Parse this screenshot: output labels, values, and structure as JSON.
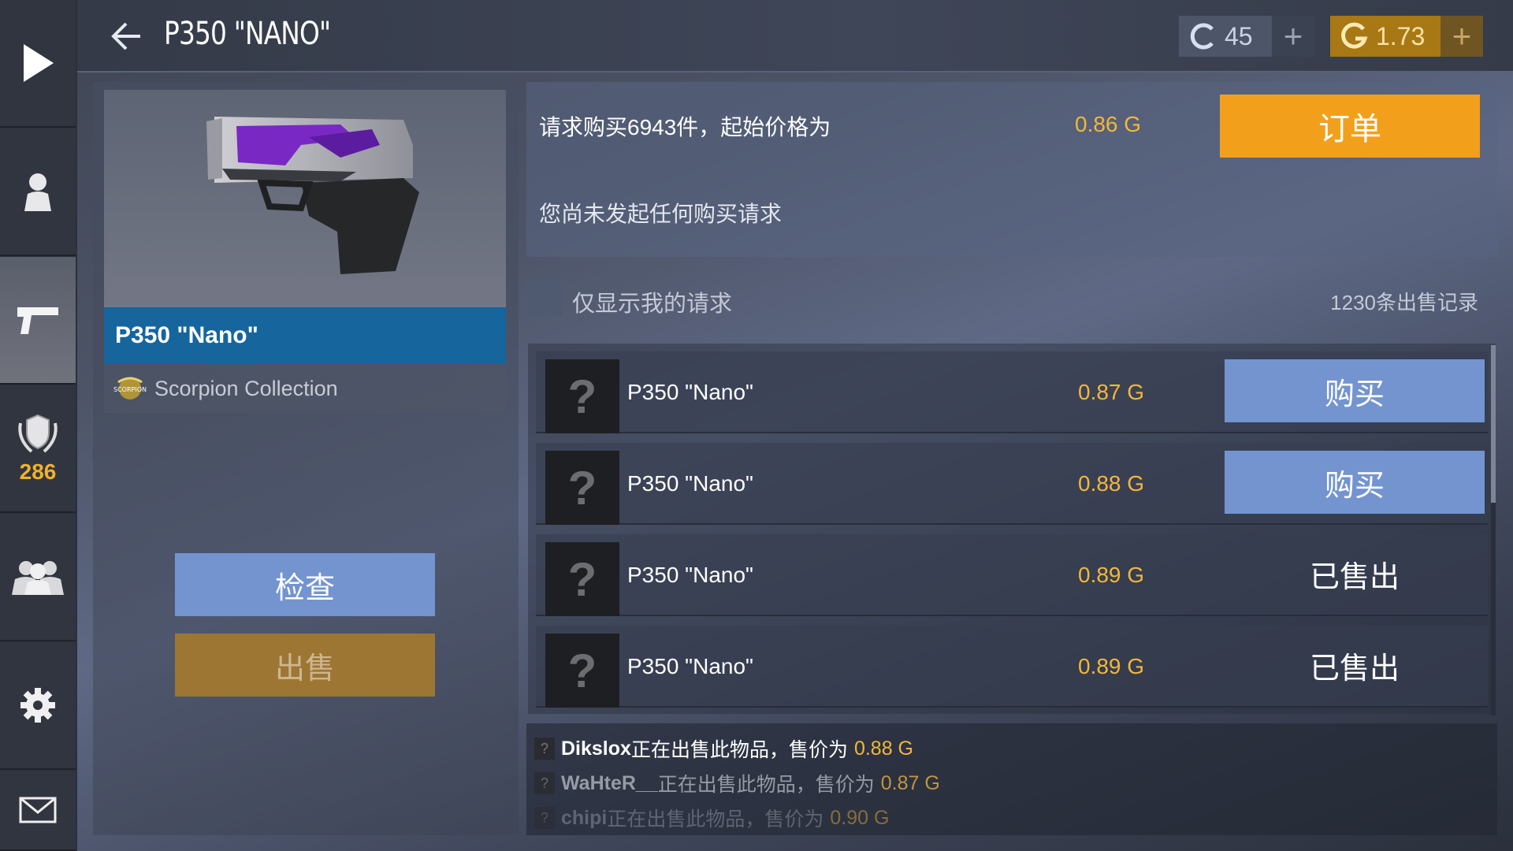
{
  "header": {
    "title": "P350 \"NANO\"",
    "currency_c": {
      "value": "45",
      "plus": "+"
    },
    "currency_g": {
      "value": "1.73",
      "plus": "+"
    }
  },
  "sidebar": {
    "items": [
      {
        "icon": "play-icon"
      },
      {
        "icon": "profile-icon"
      },
      {
        "icon": "pistol-icon",
        "active": true
      },
      {
        "icon": "rank-shield-icon",
        "count": "286"
      },
      {
        "icon": "friends-icon"
      },
      {
        "icon": "gear-icon"
      },
      {
        "icon": "mail-icon"
      }
    ]
  },
  "item": {
    "name": "P350 \"Nano\"",
    "collection": "Scorpion Collection",
    "collection_logo_text": "SCORPION",
    "inspect_label": "检查",
    "sell_label": "出售"
  },
  "order": {
    "request_text": "请求购买6943件，起始价格为",
    "start_price": "0.86 G",
    "order_button": "订单",
    "no_requests": "您尚未发起任何购买请求"
  },
  "filter": {
    "label": "仅显示我的请求",
    "sales_count": "1230条出售记录"
  },
  "listings": [
    {
      "name": "P350 \"Nano\"",
      "price": "0.87 G",
      "action": "购买",
      "action_type": "buy"
    },
    {
      "name": "P350 \"Nano\"",
      "price": "0.88 G",
      "action": "购买",
      "action_type": "buy"
    },
    {
      "name": "P350 \"Nano\"",
      "price": "0.89 G",
      "action": "已售出",
      "action_type": "sold"
    },
    {
      "name": "P350 \"Nano\"",
      "price": "0.89 G",
      "action": "已售出",
      "action_type": "sold"
    }
  ],
  "unknown_thumb": "?",
  "feed": [
    {
      "user": "Dikslox",
      "text": "正在出售此物品，售价为",
      "price": "0.88 G"
    },
    {
      "user": "WaHteR__",
      "text": "正在出售此物品，售价为",
      "price": "0.87 G"
    },
    {
      "user": "chipi",
      "text": "正在出售此物品，售价为",
      "price": "0.90 G"
    }
  ],
  "colors": {
    "accent_gold": "#f2b73a",
    "order_orange": "#f2a01b",
    "buy_blue": "#7394cf",
    "name_bar_blue": "#16659c",
    "sell_bronze": "#9d7633"
  }
}
